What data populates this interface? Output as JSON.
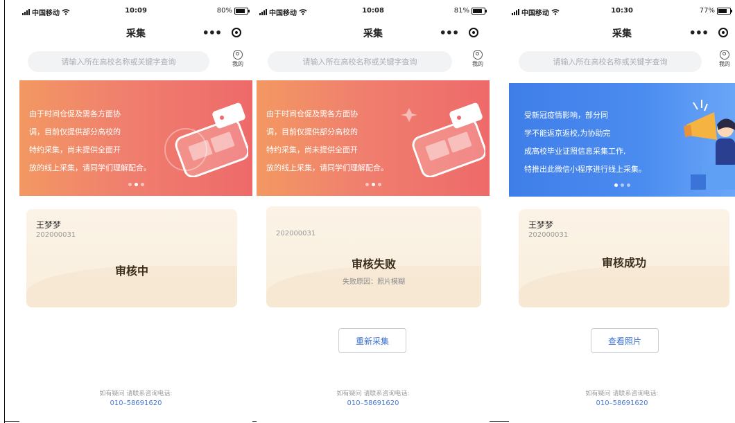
{
  "screens": [
    {
      "status": {
        "carrier": "中国移动",
        "time": "10:09",
        "battery": "80%",
        "battery_fill": 0.8
      },
      "nav": {
        "title": "采集"
      },
      "search": {
        "placeholder": "请输入所在高校名称或关键字查询"
      },
      "mine_label": "我的",
      "banner": {
        "theme": "orange",
        "lines": [
          "由于时间仓促及需各方面协",
          "调，目前仅提供部分高校的",
          "特约采集，尚未提供全面开",
          "放的线上采集，请同学们理解配合。"
        ],
        "dots": 3,
        "active_dot": 1
      },
      "card": {
        "name": "王梦梦",
        "id": "202000031",
        "status": "审核中"
      },
      "footer": {
        "note": "如有疑问 请联系咨询电话:",
        "phone": "010–58691620"
      }
    },
    {
      "status": {
        "carrier": "中国移动",
        "time": "10:08",
        "battery": "81%",
        "battery_fill": 0.81
      },
      "nav": {
        "title": "采集"
      },
      "search": {
        "placeholder": "请输入所在高校名称或关键字查询"
      },
      "mine_label": "我的",
      "banner": {
        "theme": "orange",
        "lines": [
          "由于时间仓促及需各方面协",
          "调，目前仅提供部分高校的",
          "特约采集，尚未提供全面开",
          "放的线上采集，请同学们理解配合。"
        ],
        "dots": 3,
        "active_dot": 1
      },
      "card": {
        "id": "202000031",
        "status": "审核失败",
        "reason": "失败原因：照片模糊"
      },
      "button": {
        "label": "重新采集"
      },
      "footer": {
        "note": "如有疑问 请联系咨询电话:",
        "phone": "010–58691620"
      }
    },
    {
      "status": {
        "carrier": "中国移动",
        "time": "10:30",
        "battery": "77%",
        "battery_fill": 0.77
      },
      "nav": {
        "title": "采集"
      },
      "search": {
        "placeholder": "请输入所在高校名称或关键字查询"
      },
      "mine_label": "我的",
      "banner": {
        "theme": "blue",
        "lines": [
          "受新冠疫情影响，部分同",
          "学不能返京返校,为协助完",
          "成高校毕业证照信息采集工作,",
          "特推出此微信小程序进行线上采集。"
        ],
        "dots": 3,
        "active_dot": 0
      },
      "card": {
        "name": "王梦梦",
        "id": "202000031",
        "status": "审核成功"
      },
      "button": {
        "label": "查看照片"
      },
      "footer": {
        "note": "如有疑问 请联系咨询电话:",
        "phone": "010–58691620"
      }
    }
  ],
  "colors": {
    "accent_blue": "#3b6fd1",
    "banner_orange": "#f07f6e",
    "banner_blue": "#4b8cf0",
    "card_bg": "#fbf3e6"
  },
  "icons": [
    "signal-icon",
    "wifi-icon",
    "battery-icon",
    "more-icon",
    "target-icon",
    "user-icon"
  ]
}
